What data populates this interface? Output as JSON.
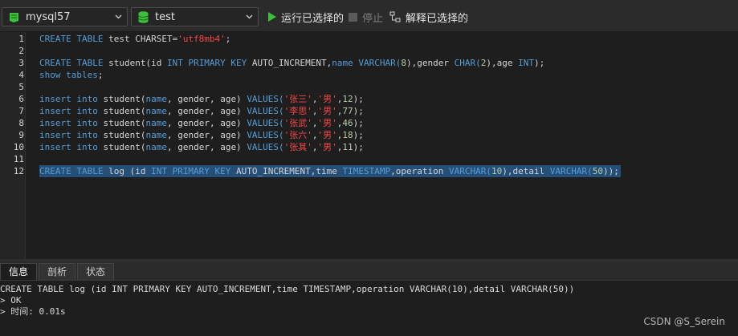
{
  "toolbar": {
    "connection": "mysql57",
    "database": "test",
    "run_selected": "运行已选择的",
    "stop": "停止",
    "explain_selected": "解释已选择的"
  },
  "editor": {
    "line_numbers": [
      "1",
      "2",
      "3",
      "4",
      "5",
      "6",
      "7",
      "8",
      "9",
      "10",
      "11",
      "12"
    ],
    "lines": [
      [
        {
          "t": "CREATE TABLE ",
          "c": "kw"
        },
        {
          "t": "test CHARSET=",
          "c": "txt"
        },
        {
          "t": "'utf8mb4'",
          "c": "str"
        },
        {
          "t": ";",
          "c": "txt"
        }
      ],
      [],
      [
        {
          "t": "CREATE TABLE ",
          "c": "kw"
        },
        {
          "t": "student(id ",
          "c": "txt"
        },
        {
          "t": "INT PRIMARY KEY ",
          "c": "kw"
        },
        {
          "t": "AUTO_INCREMENT,",
          "c": "txt"
        },
        {
          "t": "name ",
          "c": "kw"
        },
        {
          "t": "VARCHAR(",
          "c": "kw"
        },
        {
          "t": "8",
          "c": "num"
        },
        {
          "t": "),gender ",
          "c": "txt"
        },
        {
          "t": "CHAR(",
          "c": "kw"
        },
        {
          "t": "2",
          "c": "num"
        },
        {
          "t": "),age ",
          "c": "txt"
        },
        {
          "t": "INT",
          "c": "kw"
        },
        {
          "t": ");",
          "c": "txt"
        }
      ],
      [
        {
          "t": "show tables",
          "c": "kw"
        },
        {
          "t": ";",
          "c": "txt"
        }
      ],
      [],
      [
        {
          "t": "insert into ",
          "c": "kw"
        },
        {
          "t": "student(",
          "c": "txt"
        },
        {
          "t": "name",
          "c": "kw"
        },
        {
          "t": ", gender, age) ",
          "c": "txt"
        },
        {
          "t": "VALUES(",
          "c": "kw"
        },
        {
          "t": "'张三'",
          "c": "str"
        },
        {
          "t": ",",
          "c": "txt"
        },
        {
          "t": "'男'",
          "c": "str"
        },
        {
          "t": ",",
          "c": "txt"
        },
        {
          "t": "12",
          "c": "num"
        },
        {
          "t": ");",
          "c": "txt"
        }
      ],
      [
        {
          "t": "insert into ",
          "c": "kw"
        },
        {
          "t": "student(",
          "c": "txt"
        },
        {
          "t": "name",
          "c": "kw"
        },
        {
          "t": ", gender, age) ",
          "c": "txt"
        },
        {
          "t": "VALUES(",
          "c": "kw"
        },
        {
          "t": "'李思'",
          "c": "str"
        },
        {
          "t": ",",
          "c": "txt"
        },
        {
          "t": "'男'",
          "c": "str"
        },
        {
          "t": ",",
          "c": "txt"
        },
        {
          "t": "77",
          "c": "num"
        },
        {
          "t": ");",
          "c": "txt"
        }
      ],
      [
        {
          "t": "insert into ",
          "c": "kw"
        },
        {
          "t": "student(",
          "c": "txt"
        },
        {
          "t": "name",
          "c": "kw"
        },
        {
          "t": ", gender, age) ",
          "c": "txt"
        },
        {
          "t": "VALUES(",
          "c": "kw"
        },
        {
          "t": "'张武'",
          "c": "str"
        },
        {
          "t": ",",
          "c": "txt"
        },
        {
          "t": "'男'",
          "c": "str"
        },
        {
          "t": ",",
          "c": "txt"
        },
        {
          "t": "46",
          "c": "num"
        },
        {
          "t": ");",
          "c": "txt"
        }
      ],
      [
        {
          "t": "insert into ",
          "c": "kw"
        },
        {
          "t": "student(",
          "c": "txt"
        },
        {
          "t": "name",
          "c": "kw"
        },
        {
          "t": ", gender, age) ",
          "c": "txt"
        },
        {
          "t": "VALUES(",
          "c": "kw"
        },
        {
          "t": "'张六'",
          "c": "str"
        },
        {
          "t": ",",
          "c": "txt"
        },
        {
          "t": "'男'",
          "c": "str"
        },
        {
          "t": ",",
          "c": "txt"
        },
        {
          "t": "18",
          "c": "num"
        },
        {
          "t": ");",
          "c": "txt"
        }
      ],
      [
        {
          "t": "insert into ",
          "c": "kw"
        },
        {
          "t": "student(",
          "c": "txt"
        },
        {
          "t": "name",
          "c": "kw"
        },
        {
          "t": ", gender, age) ",
          "c": "txt"
        },
        {
          "t": "VALUES(",
          "c": "kw"
        },
        {
          "t": "'张其'",
          "c": "str"
        },
        {
          "t": ",",
          "c": "txt"
        },
        {
          "t": "'男'",
          "c": "str"
        },
        {
          "t": ",",
          "c": "txt"
        },
        {
          "t": "11",
          "c": "num"
        },
        {
          "t": ");",
          "c": "txt"
        }
      ],
      [],
      [
        {
          "t": "CREATE TABLE ",
          "c": "kw"
        },
        {
          "t": "log (id ",
          "c": "txt"
        },
        {
          "t": "INT PRIMARY KEY ",
          "c": "kw"
        },
        {
          "t": "AUTO_INCREMENT,time ",
          "c": "txt"
        },
        {
          "t": "TIMESTAMP",
          "c": "kw"
        },
        {
          "t": ",operation ",
          "c": "txt"
        },
        {
          "t": "VARCHAR(",
          "c": "kw"
        },
        {
          "t": "10",
          "c": "num"
        },
        {
          "t": "),detail ",
          "c": "txt"
        },
        {
          "t": "VARCHAR(",
          "c": "kw"
        },
        {
          "t": "50",
          "c": "num"
        },
        {
          "t": "));",
          "c": "txt"
        }
      ]
    ],
    "selected_line": 12
  },
  "result_tabs": [
    "信息",
    "剖析",
    "状态"
  ],
  "output": {
    "lines": [
      "CREATE TABLE log (id INT PRIMARY KEY AUTO_INCREMENT,time TIMESTAMP,operation VARCHAR(10),detail VARCHAR(50))",
      "> OK",
      "> 时间: 0.01s"
    ]
  },
  "watermark": "CSDN @S_Serein",
  "colors": {
    "background": "#1e1e1e",
    "keyword": "#569cd6",
    "string": "#f44747",
    "number": "#b5cea8",
    "selection": "#264f78",
    "run_icon": "#3cbf3c",
    "db_icon": "#3cbf3c"
  }
}
